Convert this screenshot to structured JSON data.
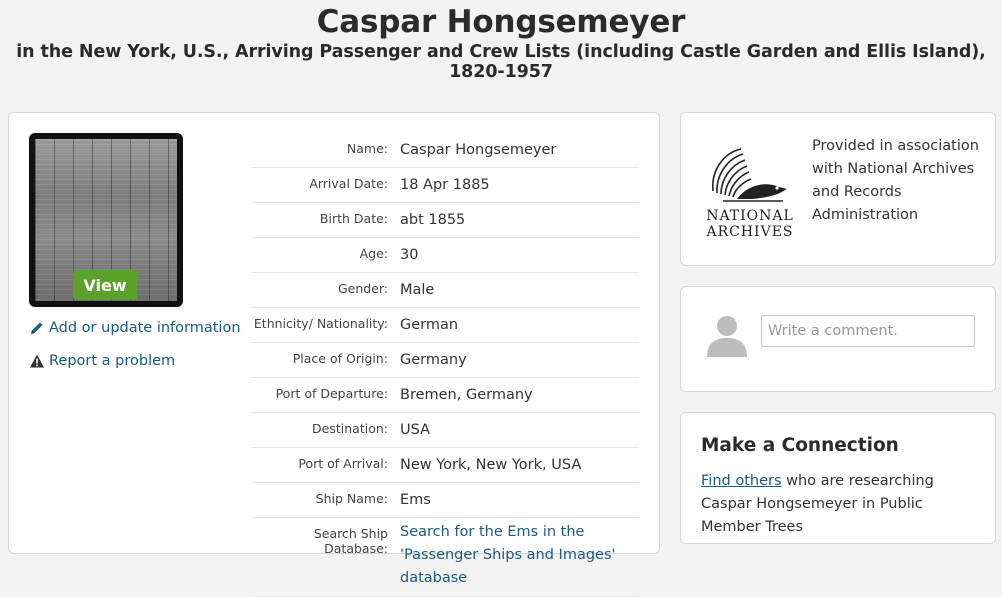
{
  "header": {
    "name": "Caspar Hongsemeyer",
    "collection": "in the New York, U.S., Arriving Passenger and Crew Lists (including Castle Garden and Ellis Island), 1820-1957"
  },
  "record_image": {
    "view_label": "View"
  },
  "links": {
    "add_update": "Add or update information",
    "report": "Report a problem"
  },
  "facts": [
    {
      "label": "Name:",
      "value": "Caspar Hongsemeyer"
    },
    {
      "label": "Arrival Date:",
      "value": "18 Apr 1885"
    },
    {
      "label": "Birth Date:",
      "value": "abt 1855"
    },
    {
      "label": "Age:",
      "value": "30"
    },
    {
      "label": "Gender:",
      "value": "Male"
    },
    {
      "label": "Ethnicity/ Nationality:",
      "value": "German"
    },
    {
      "label": "Place of Origin:",
      "value": "Germany"
    },
    {
      "label": "Port of Departure:",
      "value": "Bremen, Germany"
    },
    {
      "label": "Destination:",
      "value": "USA"
    },
    {
      "label": "Port of Arrival:",
      "value": "New York, New York, USA"
    },
    {
      "label": "Ship Name:",
      "value": "Ems"
    },
    {
      "label": "Search Ship Database:",
      "value": "Search for the Ems in the 'Passenger Ships and Images' database"
    }
  ],
  "archive": {
    "logo_line1": "NATIONAL",
    "logo_line2": "ARCHIVES",
    "text": "Provided in association with National Archives and Records Administration"
  },
  "comment": {
    "placeholder": "Write a comment."
  },
  "connection": {
    "title": "Make a Connection",
    "link_text": "Find others",
    "text": " who are researching Caspar Hongsemeyer in Public Member Trees"
  },
  "colors": {
    "link": "#1a5b82",
    "view_button": "#5aa22a",
    "background": "#f3f3f3"
  },
  "icons": {
    "add_update": "pencil-icon",
    "report": "warning-icon",
    "avatar": "user-silhouette-icon",
    "archive_logo": "national-archives-eagle-logo"
  }
}
